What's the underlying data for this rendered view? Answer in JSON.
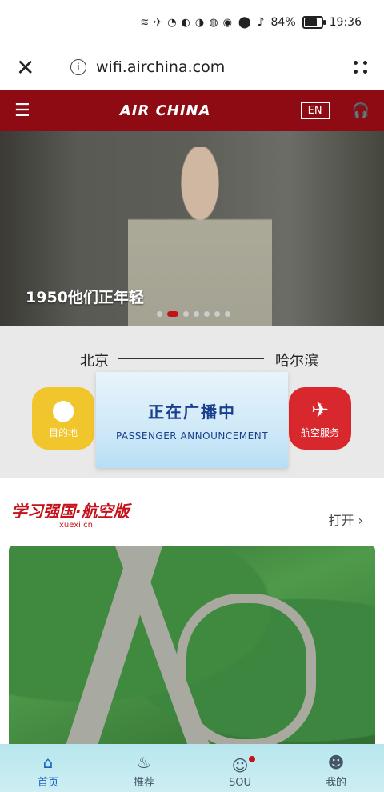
{
  "status_bar": {
    "battery": "84%",
    "time": "19:36",
    "icons": [
      "wifi-icon",
      "airplane-icon",
      "wifi-signal-icon",
      "app-icon",
      "app-icon",
      "globe-icon",
      "weibo-icon",
      "location-icon",
      "mute-icon",
      "battery-icon"
    ],
    "battery_level": 0.84
  },
  "browser": {
    "url": "wifi.airchina.com",
    "close_label": "✕",
    "info_label": "i",
    "menu_label": "⋮"
  },
  "header": {
    "brand": "AIR CHINA",
    "language": "EN",
    "brand_color": "#8f0b14"
  },
  "banner": {
    "caption": "1950他们正年轻",
    "slide_count": 7,
    "active_slide": 2
  },
  "route": {
    "from": "北京",
    "to": "哈尔滨"
  },
  "services": {
    "destination_label": "目的地",
    "air_service_label": "航空服务"
  },
  "announcement": {
    "title_cn": "正在广播中",
    "title_en": "PASSENGER ANNOUNCEMENT"
  },
  "xuexi": {
    "title": "学习强国·航空版",
    "subtitle": "xuexi.cn",
    "open_label": "打开",
    "open_icon": "chevron-right-icon"
  },
  "tabs": [
    {
      "label": "首页",
      "icon": "home-icon",
      "active": true
    },
    {
      "label": "推荐",
      "icon": "flame-icon",
      "active": false
    },
    {
      "label": "SOU",
      "icon": "chat-icon",
      "active": false,
      "badge": true
    },
    {
      "label": "我的",
      "icon": "user-icon",
      "active": false
    }
  ]
}
